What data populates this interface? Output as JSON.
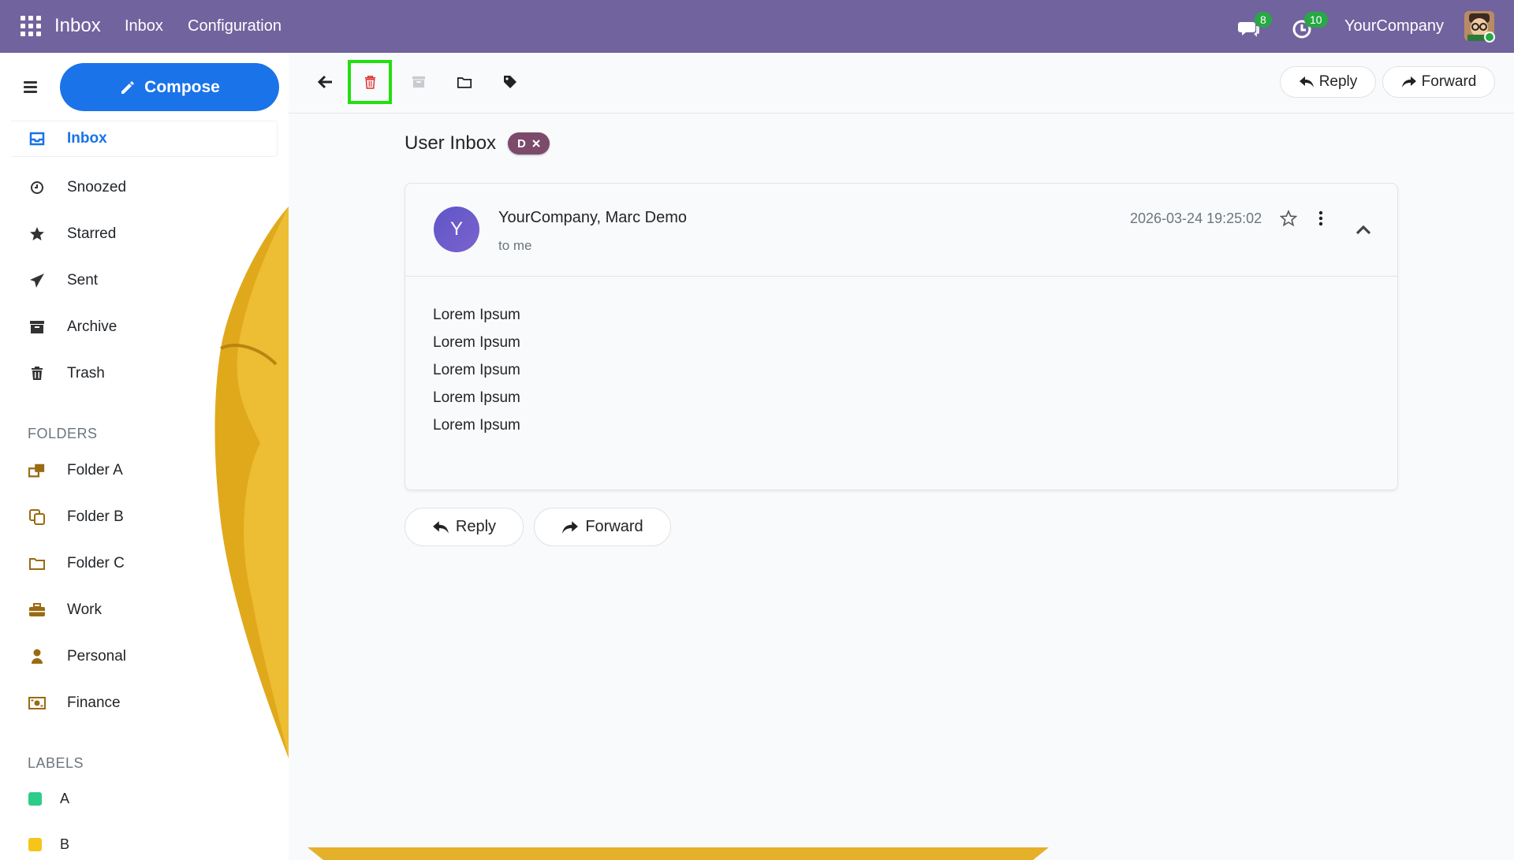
{
  "navbar": {
    "brand": "Inbox",
    "menu": [
      "Inbox",
      "Configuration"
    ],
    "messages_badge": "8",
    "activities_badge": "10",
    "company": "YourCompany",
    "color": "#71639e"
  },
  "sidebar": {
    "compose_label": "Compose",
    "items": [
      {
        "label": "Inbox",
        "icon": "inbox-icon"
      },
      {
        "label": "Snoozed",
        "icon": "clock-icon"
      },
      {
        "label": "Starred",
        "icon": "star-icon"
      },
      {
        "label": "Sent",
        "icon": "paper-plane-icon"
      },
      {
        "label": "Archive",
        "icon": "archive-icon"
      },
      {
        "label": "Trash",
        "icon": "trash-icon"
      }
    ],
    "folders_heading": "FOLDERS",
    "folders": [
      {
        "label": "Folder A",
        "icon": "folder-stack-icon"
      },
      {
        "label": "Folder B",
        "icon": "folder-copy-icon"
      },
      {
        "label": "Folder C",
        "icon": "folder-icon"
      },
      {
        "label": "Work",
        "icon": "briefcase-icon"
      },
      {
        "label": "Personal",
        "icon": "user-icon"
      },
      {
        "label": "Finance",
        "icon": "money-icon"
      }
    ],
    "labels_heading": "LABELS",
    "labels": [
      {
        "label": "A",
        "color": "#2ecc8a"
      },
      {
        "label": "B",
        "color": "#f5c518"
      }
    ]
  },
  "toolbar": {
    "reply_label": "Reply",
    "forward_label": "Forward"
  },
  "main": {
    "title": "User Inbox",
    "tag": "D",
    "message": {
      "avatar_letter": "Y",
      "sender": "YourCompany, Marc Demo",
      "to": "to me",
      "date": "2026-03-24 19:25:02",
      "body": [
        "Lorem Ipsum",
        "Lorem Ipsum",
        "Lorem Ipsum",
        "Lorem Ipsum",
        "Lorem Ipsum"
      ]
    },
    "reply_label": "Reply",
    "forward_label": "Forward"
  }
}
